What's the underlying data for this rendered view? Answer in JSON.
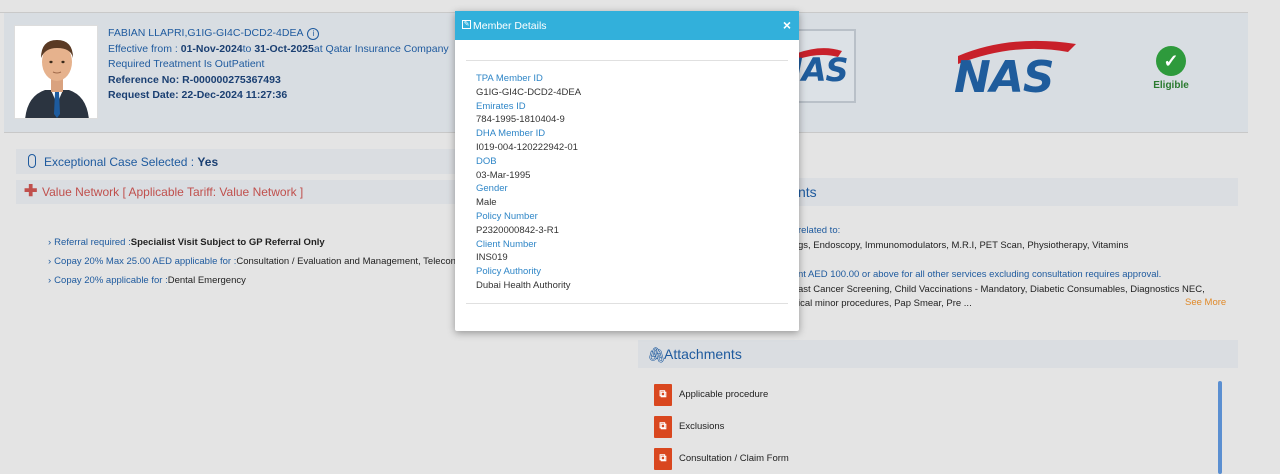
{
  "member": {
    "name": "FABIAN LLAPRI,G1IG-GI4C-DCD2-4DEA",
    "effective_label": "Effective from : ",
    "effective_from": "01-Nov-2024",
    "effective_to_label": "to ",
    "effective_to": "31-Oct-2025",
    "insurer": "at Qatar Insurance Company",
    "treatment": "Required Treatment Is OutPatient",
    "reference_label": "Reference No: ",
    "reference_no": "R-000000275367493",
    "request_label": "Request Date: ",
    "request_date": "22-Dec-2024 11:27:36"
  },
  "logos": {
    "nas": "NAS"
  },
  "eligibility": {
    "label": "Eligible"
  },
  "exceptional": {
    "label": "Exceptional Case Selected : ",
    "value": "Yes"
  },
  "network": {
    "label": "Value Network [ Applicable Tariff: Value Network ]"
  },
  "referrals": [
    {
      "key": "Referral required :",
      "value": "Specialist Visit Subject to GP Referral Only",
      "bold": true
    },
    {
      "key": "Copay 20% Max 25.00 AED applicable for :",
      "value": "Consultation / Evaluation and Management, Teleconsu"
    },
    {
      "key": "Copay 20% applicable for :",
      "value": "Dental Emergency"
    }
  ],
  "right_panel": {
    "title": "nts",
    "line1": "related to:",
    "line2": "gs, Endoscopy, Immunomodulators, M.R.I, PET Scan, Physiotherapy, Vitamins",
    "line3": "nt AED 100.00 or above for all other services excluding consultation requires approval.",
    "line4": "ast Cancer Screening, Child Vaccinations - Mandatory, Diabetic Consumables, Diagnostics NEC,",
    "line5": "ical minor procedures, Pap Smear, Pre ...",
    "see_more": "See More"
  },
  "attachments": {
    "title": "Attachments",
    "items": [
      {
        "label": "Applicable procedure"
      },
      {
        "label": "Exclusions"
      },
      {
        "label": "Consultation / Claim Form"
      }
    ]
  },
  "modal": {
    "title": "Member Details",
    "close": "×",
    "fields": [
      {
        "key": "TPA Member ID",
        "value": "G1IG-GI4C-DCD2-4DEA"
      },
      {
        "key": "Emirates ID",
        "value": "784-1995-1810404-9"
      },
      {
        "key": "DHA Member ID",
        "value": "I019-004-120222942-01"
      },
      {
        "key": "DOB",
        "value": "03-Mar-1995"
      },
      {
        "key": "Gender",
        "value": "Male"
      },
      {
        "key": "Policy Number",
        "value": "P2320000842-3-R1"
      },
      {
        "key": "Client Number",
        "value": "INS019"
      },
      {
        "key": "Policy Authority",
        "value": "Dubai Health Authority"
      }
    ]
  },
  "colors": {
    "modal_header": "#32b0db",
    "link_blue": "#1e5a9e",
    "eligible_green": "#2e9a3c",
    "network_red": "#c0504d",
    "pdf_red": "#d9471f"
  }
}
